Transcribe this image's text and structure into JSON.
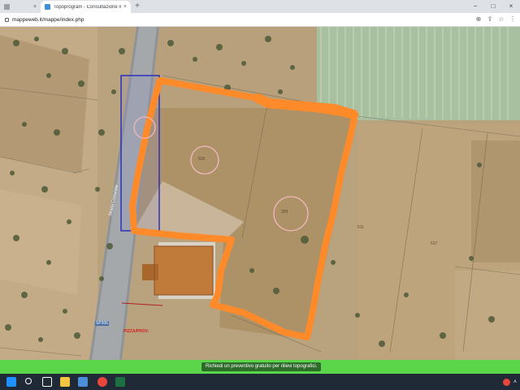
{
  "browser": {
    "tabs": [
      {
        "title": "",
        "active": false
      },
      {
        "title": "Topoprogram - Consultazione m",
        "active": true
      }
    ],
    "url": "mappeweb.it/mappe/index.php",
    "buttons": {
      "minimize": "−",
      "maximize": "□",
      "close": "×",
      "new_tab": "+",
      "back": "←",
      "forward": "→",
      "reload": "↻"
    }
  },
  "map": {
    "parcels": [
      {
        "number": "539"
      },
      {
        "number": "329"
      },
      {
        "number": "511"
      },
      {
        "number": "517"
      }
    ],
    "road_label": "Strada Comunale",
    "sp_label": "SP306",
    "red_label": "PIZZA/PROV."
  },
  "banner": {
    "label": "Richiedi un preventivo gratuito per rilievi topografici."
  },
  "taskbar": {
    "icons": [
      "windows-start-icon",
      "search-icon",
      "task-view-icon",
      "file-explorer-icon",
      "calendar-icon",
      "store-icon",
      "chrome-icon",
      "excel-icon"
    ]
  },
  "colors": {
    "outline_orange": "#ff8a2a",
    "blue_rect": "#2b2fb8",
    "banner_green": "#5bd64b",
    "taskbar": "#1f2a36"
  }
}
